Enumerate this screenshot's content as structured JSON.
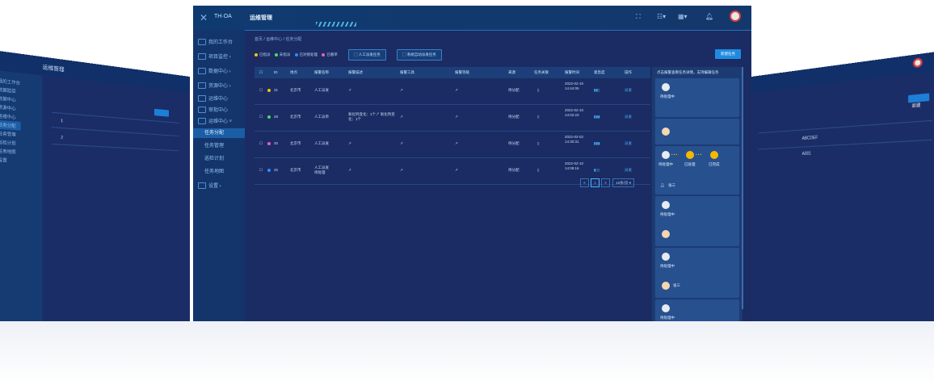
{
  "header": {
    "logo_text": "TH·OA",
    "title": "运维管理",
    "icons": [
      "expand-icon",
      "list-icon",
      "grid-icon",
      "bell-icon"
    ]
  },
  "nav": {
    "items": [
      {
        "label": "我的工作台",
        "icon": "desk-icon"
      },
      {
        "label": "项目监控",
        "icon": "monitor-icon"
      },
      {
        "label": "数据中心",
        "icon": "data-icon"
      },
      {
        "label": "资源中心",
        "icon": "resource-icon"
      },
      {
        "label": "运维中心",
        "icon": "ops-icon"
      },
      {
        "label": "审批中心",
        "icon": "approve-icon"
      },
      {
        "label": "运维中心",
        "icon": "ops2-icon"
      }
    ],
    "sub_items": [
      "任务分配",
      "任务管理",
      "巡检计划",
      "任务地图"
    ],
    "settings": "设置"
  },
  "breadcrumb": "首页 / 运维中心 / 任务分配",
  "legend": [
    {
      "label": "已指派",
      "color": "#f5c400"
    },
    {
      "label": "未指派",
      "color": "#4cd964"
    },
    {
      "label": "已对接处理",
      "color": "#2f8cff"
    },
    {
      "label": "已撤单",
      "color": "#e85cc6"
    }
  ],
  "tabs": [
    "人工派发任务",
    "系统自动派发任务"
  ],
  "create_button": "新建任务",
  "table": {
    "headers": [
      "ID",
      "地点",
      "报警名称",
      "报警描述",
      "报警工具",
      "报警等级",
      "来源",
      "任务关联",
      "报警时间",
      "紧急度",
      "操作"
    ],
    "rows": [
      {
        "id": "31",
        "dot": "#f5c400",
        "place": "北京市",
        "name": "人工派发",
        "desc": "↗",
        "tool": "↗",
        "level": "↗",
        "source": "待分配",
        "time": "2022-02-10 14:44:05",
        "action": "派发"
      },
      {
        "id": "28",
        "dot": "#4cd964",
        "place": "北京市",
        "name": "人工派单",
        "desc": "氧化钙变化：1个↗ 氧化钙变化：1个",
        "tool": "↗",
        "level": "↗",
        "source": "待分配",
        "time": "2022-02-10 14:02:23",
        "action": "派发"
      },
      {
        "id": "30",
        "dot": "#e85cc6",
        "place": "北京市",
        "name": "人工派发",
        "desc": "↗",
        "tool": "↗",
        "level": "↗",
        "source": "待分配",
        "time": "2022-02-02 14:30:31",
        "action": "派发"
      },
      {
        "id": "25",
        "dot": "#2f8cff",
        "place": "北京市",
        "name": "人工派发 待处理",
        "desc": "↗",
        "tool": "↗",
        "level": "↗",
        "source": "待分配",
        "time": "2022-02-10 14:08:16",
        "action": "派发"
      }
    ]
  },
  "pager": {
    "prev": "<",
    "page": "1",
    "next": ">",
    "size": "10条/页"
  },
  "panel": {
    "title": "点击报警查看任务详情，支持编辑任务",
    "cards": [
      {
        "status": "待处理中",
        "person": ""
      },
      {
        "status": "",
        "person": ""
      },
      {
        "status": "待处理中",
        "person": "张三",
        "nodes": [
          "待处理中",
          "已处理",
          "已完成"
        ]
      },
      {
        "status": "待处理中",
        "person": ""
      },
      {
        "status": "待处理中",
        "person": "张三"
      },
      {
        "status": "待处理中",
        "person": ""
      }
    ]
  },
  "side_left": {
    "title": "运维管理",
    "nav": [
      "我的工作台",
      "数据监控",
      "数据中心",
      "资源中心",
      "运维中心",
      "任务分配",
      "任务管理",
      "巡检计划",
      "任务地图",
      "设置"
    ],
    "rows": [
      "1",
      "2"
    ]
  },
  "side_right": {
    "rows": [
      "ABCDEF",
      "A001"
    ],
    "button": "新建"
  }
}
